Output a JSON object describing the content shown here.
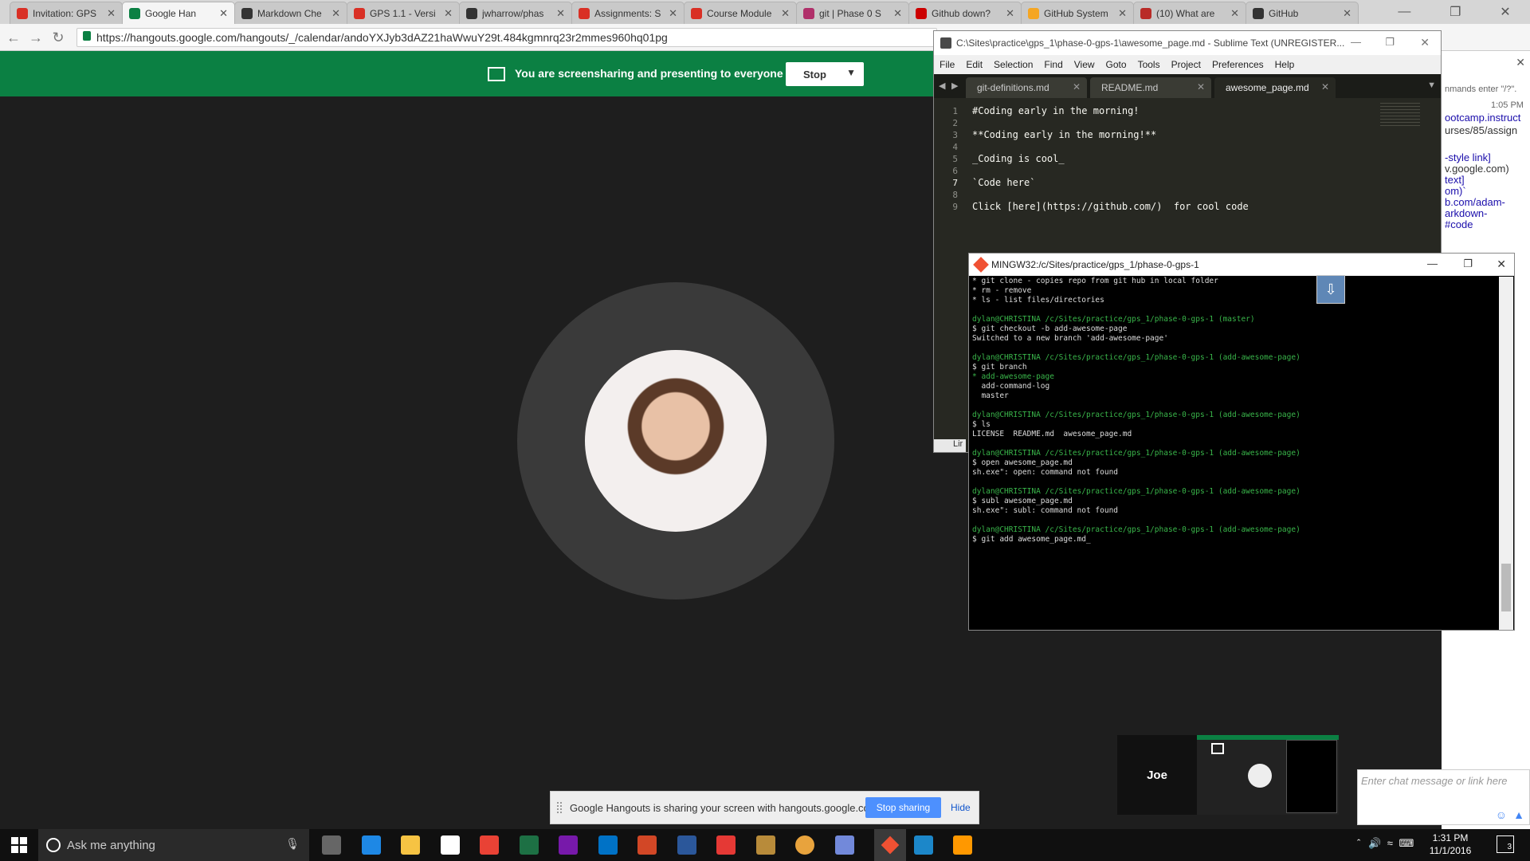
{
  "browser": {
    "tabs": [
      {
        "label": "Invitation: GPS",
        "color": "#d93025"
      },
      {
        "label": "Google Han",
        "color": "#0b8043"
      },
      {
        "label": "Markdown Che",
        "color": "#333333"
      },
      {
        "label": "GPS 1.1 - Versi",
        "color": "#d93025"
      },
      {
        "label": "jwharrow/phas",
        "color": "#333333"
      },
      {
        "label": "Assignments: S",
        "color": "#d93025"
      },
      {
        "label": "Course Module",
        "color": "#d93025"
      },
      {
        "label": "git | Phase 0 S",
        "color": "#b0306a"
      },
      {
        "label": "Github down?",
        "color": "#cc0000"
      },
      {
        "label": "GitHub System",
        "color": "#f5a623"
      },
      {
        "label": "(10) What are",
        "color": "#b92b27"
      },
      {
        "label": "GitHub",
        "color": "#333333"
      }
    ],
    "url": "https://hangouts.google.com/hangouts/_/calendar/andoYXJyb3dAZ21haWwuY29t.484kgmnrq23r2mmes960hq01pg"
  },
  "hangout": {
    "sharing_message": "You are screensharing and presenting to everyone",
    "stop_label": "Stop",
    "notice_text": "Google Hangouts is sharing your screen with hangouts.google.com.",
    "stop_sharing_label": "Stop sharing",
    "hide_label": "Hide",
    "participant_name": "Joe",
    "chat_placeholder": "Enter chat message or link here",
    "chat_lines": [
      "nmands enter \"/?\".",
      "1:05 PM",
      "ootcamp.instruct",
      "urses/85/assign",
      "-style link]",
      "v.google.com)",
      "text]",
      "om)`",
      "b.com/adam-",
      "arkdown-",
      "#code"
    ]
  },
  "sublime": {
    "title": "C:\\Sites\\practice\\gps_1\\phase-0-gps-1\\awesome_page.md - Sublime Text (UNREGISTER...",
    "menu": [
      "File",
      "Edit",
      "Selection",
      "Find",
      "View",
      "Goto",
      "Tools",
      "Project",
      "Preferences",
      "Help"
    ],
    "tabs": [
      "git-definitions.md",
      "README.md",
      "awesome_page.md"
    ],
    "lines": [
      {
        "n": "1",
        "text": "#Coding early in the morning!"
      },
      {
        "n": "2",
        "text": ""
      },
      {
        "n": "3",
        "text": "**Coding early in the morning!**"
      },
      {
        "n": "4",
        "text": ""
      },
      {
        "n": "5",
        "text": "_Coding is cool_"
      },
      {
        "n": "6",
        "text": ""
      },
      {
        "n": "7",
        "text": "`Code here`"
      },
      {
        "n": "8",
        "text": ""
      },
      {
        "n": "9",
        "text": "Click [here](https://github.com/)  for cool code"
      }
    ],
    "status_label": "Lir"
  },
  "bash": {
    "title": "MINGW32:/c/Sites/practice/gps_1/phase-0-gps-1",
    "lines": [
      {
        "t": "* git clone - copies repo from git hub in local folder",
        "c": ""
      },
      {
        "t": "* rm - remove",
        "c": ""
      },
      {
        "t": "* ls - list files/directories",
        "c": ""
      },
      {
        "t": "",
        "c": ""
      },
      {
        "t": "dylan@CHRISTINA /c/Sites/practice/gps_1/phase-0-gps-1 (master)",
        "c": "p"
      },
      {
        "t": "$ git checkout -b add-awesome-page",
        "c": ""
      },
      {
        "t": "Switched to a new branch 'add-awesome-page'",
        "c": ""
      },
      {
        "t": "",
        "c": ""
      },
      {
        "t": "dylan@CHRISTINA /c/Sites/practice/gps_1/phase-0-gps-1 (add-awesome-page)",
        "c": "p"
      },
      {
        "t": "$ git branch",
        "c": ""
      },
      {
        "t": "* add-awesome-page",
        "c": "g"
      },
      {
        "t": "  add-command-log",
        "c": ""
      },
      {
        "t": "  master",
        "c": ""
      },
      {
        "t": "",
        "c": ""
      },
      {
        "t": "dylan@CHRISTINA /c/Sites/practice/gps_1/phase-0-gps-1 (add-awesome-page)",
        "c": "p"
      },
      {
        "t": "$ ls",
        "c": ""
      },
      {
        "t": "LICENSE  README.md  awesome_page.md",
        "c": ""
      },
      {
        "t": "",
        "c": ""
      },
      {
        "t": "dylan@CHRISTINA /c/Sites/practice/gps_1/phase-0-gps-1 (add-awesome-page)",
        "c": "p"
      },
      {
        "t": "$ open awesome_page.md",
        "c": ""
      },
      {
        "t": "sh.exe\": open: command not found",
        "c": ""
      },
      {
        "t": "",
        "c": ""
      },
      {
        "t": "dylan@CHRISTINA /c/Sites/practice/gps_1/phase-0-gps-1 (add-awesome-page)",
        "c": "p"
      },
      {
        "t": "$ subl awesome_page.md",
        "c": ""
      },
      {
        "t": "sh.exe\": subl: command not found",
        "c": ""
      },
      {
        "t": "",
        "c": ""
      },
      {
        "t": "dylan@CHRISTINA /c/Sites/practice/gps_1/phase-0-gps-1 (add-awesome-page)",
        "c": "p"
      },
      {
        "t": "$ git add awesome_page.md_",
        "c": ""
      }
    ]
  },
  "taskbar": {
    "search_placeholder": "Ask me anything",
    "time": "1:31 PM",
    "date": "11/1/2016",
    "notifications": "3",
    "apps": [
      {
        "name": "task-view-icon",
        "color": "#666666"
      },
      {
        "name": "edge-icon",
        "color": "#1e88e5"
      },
      {
        "name": "file-explorer-icon",
        "color": "#f6c343"
      },
      {
        "name": "store-icon",
        "color": "#ffffff"
      },
      {
        "name": "picasa-icon",
        "color": "#e94235"
      },
      {
        "name": "excel-icon",
        "color": "#1d7044"
      },
      {
        "name": "onenote-icon",
        "color": "#7719aa"
      },
      {
        "name": "outlook-icon",
        "color": "#0072c6"
      },
      {
        "name": "powerpoint-icon",
        "color": "#d24726"
      },
      {
        "name": "word-icon",
        "color": "#2b579a"
      },
      {
        "name": "calculator-icon",
        "color": "#e53935"
      },
      {
        "name": "kodi-icon",
        "color": "#b88b3a"
      },
      {
        "name": "chrome-icon",
        "color": "#e8a33d"
      },
      {
        "name": "discord-icon",
        "color": "#7289da"
      },
      {
        "name": "git-icon",
        "color": "#f05133"
      },
      {
        "name": "vpn-icon",
        "color": "#1c87c9"
      },
      {
        "name": "sublime-icon",
        "color": "#ff9800"
      }
    ]
  }
}
